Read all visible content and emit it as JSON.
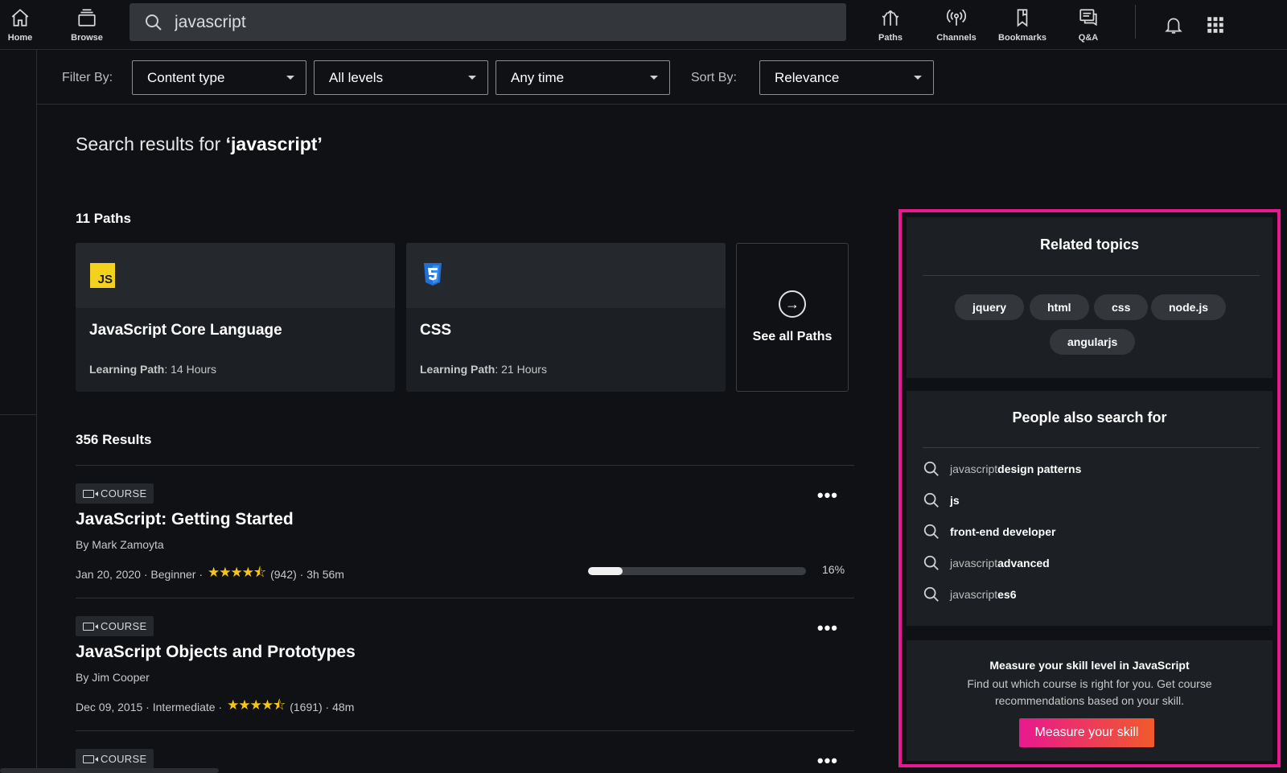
{
  "nav": {
    "home": "Home",
    "browse": "Browse",
    "paths": "Paths",
    "channels": "Channels",
    "bookmarks": "Bookmarks",
    "qa": "Q&A"
  },
  "search": {
    "value": "javascript"
  },
  "filters": {
    "filter_label": "Filter By:",
    "content_type": "Content type",
    "levels": "All levels",
    "time": "Any time",
    "sort_label": "Sort By:",
    "sort": "Relevance"
  },
  "main": {
    "title_prefix": "Search results for ",
    "title_query": "‘javascript’",
    "paths_heading": "11 Paths",
    "paths": [
      {
        "title": "JavaScript Core Language",
        "meta_label": "Learning Path",
        "meta_value": ": 14 Hours",
        "logo": "JS"
      },
      {
        "title": "CSS",
        "meta_label": "Learning Path",
        "meta_value": ": 21 Hours",
        "logo": "css3-logo"
      }
    ],
    "see_all": "See all Paths",
    "results_heading": "356 Results",
    "courses": [
      {
        "badge": "COURSE",
        "title": "JavaScript: Getting Started",
        "author": "By Mark Zamoyta",
        "date": "Jan 20, 2020",
        "level": "Beginner",
        "stars": "★★★★⯪",
        "ratings": "(942)",
        "duration": "3h 56m",
        "progress": 0.16,
        "progress_label": "16%"
      },
      {
        "badge": "COURSE",
        "title": "JavaScript Objects and Prototypes",
        "author": "By Jim Cooper",
        "date": "Dec 09, 2015",
        "level": "Intermediate",
        "stars": "★★★★⯪",
        "ratings": "(1691)",
        "duration": "48m"
      },
      {
        "badge": "COURSE"
      }
    ]
  },
  "sidebar": {
    "related_heading": "Related topics",
    "topics": [
      "jquery",
      "html",
      "css",
      "node.js",
      "angularjs"
    ],
    "also_heading": "People also search for",
    "also": [
      {
        "plain": "javascript ",
        "bold": "design patterns"
      },
      {
        "plain": "",
        "bold": "js"
      },
      {
        "plain": "",
        "bold": "front-end developer"
      },
      {
        "plain": "javascript ",
        "bold": "advanced"
      },
      {
        "plain": "javascript ",
        "bold": "es6"
      }
    ],
    "skill_heading": "Measure your skill level in JavaScript",
    "skill_text": "Find out which course is right for you. Get course recommendations based on your skill.",
    "skill_button": "Measure your skill"
  },
  "colors": {
    "accent_border": "#e8188f",
    "star": "#f5c518",
    "button_gradient_start": "#e8188f",
    "button_gradient_end": "#f15b2a"
  }
}
